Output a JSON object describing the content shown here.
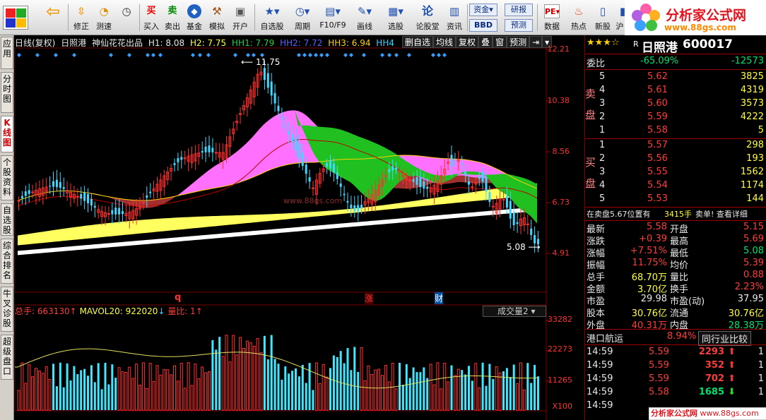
{
  "toolbar": {
    "items": [
      {
        "label": "",
        "icon": "app-logo-icon"
      },
      {
        "label": "",
        "icon": "back-arrow-icon"
      },
      {
        "label": "修正",
        "icon": "modify-icon"
      },
      {
        "label": "测速",
        "icon": "speed-test-icon"
      },
      {
        "label": "买入",
        "icon": "buy-icon",
        "glyph": "买"
      },
      {
        "label": "卖出",
        "icon": "sell-icon",
        "glyph": "卖"
      },
      {
        "label": "基金",
        "icon": "fund-icon"
      },
      {
        "label": "模拟",
        "icon": "hammer-icon"
      },
      {
        "label": "开户",
        "icon": "lock-icon"
      },
      {
        "label": "自选股",
        "icon": "watchlist-icon"
      },
      {
        "label": "周期",
        "icon": "clock-icon"
      },
      {
        "label": "F10/F9",
        "icon": "f10-icon"
      },
      {
        "label": "画线",
        "icon": "pencil-icon"
      },
      {
        "label": "选股",
        "icon": "select-stock-icon"
      },
      {
        "label": "论股堂",
        "icon": "forum-icon",
        "glyph": "论"
      },
      {
        "label": "资讯",
        "icon": "news-icon"
      },
      {
        "label": "资金",
        "icon": "capital-icon"
      },
      {
        "label": "BBD",
        "icon": "bbd-icon"
      },
      {
        "label": "研报",
        "icon": "research-icon"
      },
      {
        "label": "预测",
        "icon": "forecast-icon"
      },
      {
        "label": "数据",
        "icon": "data-icon"
      },
      {
        "label": "热点",
        "icon": "hot-icon"
      },
      {
        "label": "新股",
        "icon": "ipo-icon"
      },
      {
        "label": "沪",
        "icon": "sh-icon"
      }
    ],
    "brand_title": "分析家公式网",
    "brand_url": "www.88gs.com"
  },
  "left_tabs": [
    "应用",
    "分时图",
    "K线图",
    "个股资料",
    "自选股",
    "综合排名",
    "牛叉诊股",
    "超级盘口"
  ],
  "kline": {
    "period": "日线(复权)",
    "stock": "日照港",
    "indicator": "神仙花花出品",
    "h1": "H1: 8.08",
    "h2": "H2: 7.75",
    "hh1": "HH1: 7.79",
    "hh2": "HH2: 7.72",
    "hh3": "HH3: 6.94",
    "hh4": "HH4",
    "buttons": [
      "删自选",
      "均线",
      "复权",
      "叠",
      "窗",
      "预测"
    ],
    "y_labels": [
      "12.21",
      "10.38",
      "8.56",
      "6.73",
      "4.91"
    ],
    "high_note": "11.75",
    "low_note": "5.08",
    "marks": [
      "q",
      "涨",
      "财"
    ],
    "watermark": "www.88gs.com"
  },
  "volume": {
    "total": "总手: 663130",
    "mavol": "MAVOL20: 922020",
    "ratio": "量比: 1",
    "selector": "成交量2",
    "y_labels": [
      "33282",
      "22273",
      "11265"
    ],
    "unit": "X100"
  },
  "quote": {
    "stars": "★★★☆",
    "prefix": "R",
    "name": "日照港",
    "code": "600017",
    "weibi_label": "委比",
    "weibi": "-65.09%",
    "weicha": "-12573",
    "sell_label": "卖盘",
    "buy_label": "买盘",
    "sells": [
      {
        "lvl": "5",
        "price": "5.62",
        "vol": "3825"
      },
      {
        "lvl": "4",
        "price": "5.61",
        "vol": "4319"
      },
      {
        "lvl": "3",
        "price": "5.60",
        "vol": "3573"
      },
      {
        "lvl": "2",
        "price": "5.59",
        "vol": "4222"
      },
      {
        "lvl": "1",
        "price": "5.58",
        "vol": "5"
      }
    ],
    "buys": [
      {
        "lvl": "1",
        "price": "5.57",
        "vol": "298"
      },
      {
        "lvl": "2",
        "price": "5.56",
        "vol": "193"
      },
      {
        "lvl": "3",
        "price": "5.55",
        "vol": "1562"
      },
      {
        "lvl": "4",
        "price": "5.54",
        "vol": "1174"
      },
      {
        "lvl": "5",
        "price": "5.53",
        "vol": "144"
      }
    ],
    "notice_left": "在卖盘5.67位置有",
    "notice_mid": "3415手",
    "notice_right": "卖单! 查看详细",
    "stats": [
      {
        "k1": "最新",
        "v1": "5.58",
        "k2": "开盘",
        "v2": "5.15"
      },
      {
        "k1": "涨跌",
        "v1": "+0.39",
        "k2": "最高",
        "v2": "5.69"
      },
      {
        "k1": "涨幅",
        "v1": "+7.51%",
        "k2": "最低",
        "v2": "5.08"
      },
      {
        "k1": "振幅",
        "v1": "11.75%",
        "k2": "均价",
        "v2": "5.39"
      },
      {
        "k1": "总手",
        "v1": "68.70万",
        "k2": "量比",
        "v2": "0.88"
      },
      {
        "k1": "金额",
        "v1": "3.70亿",
        "k2": "换手",
        "v2": "2.23%"
      },
      {
        "k1": "市盈",
        "v1": "29.98",
        "k2": "市盈(动)",
        "v2": "37.95"
      },
      {
        "k1": "股本",
        "v1": "30.76亿",
        "k2": "流通",
        "v2": "30.76亿"
      },
      {
        "k1": "外盘",
        "v1": "40.31万",
        "k2": "内盘",
        "v2": "28.38万"
      }
    ],
    "sector": "港口航运",
    "sector_pct": "8.94%",
    "compare_btn": "同行业比较",
    "ticks": [
      {
        "t": "14:59",
        "p": "5.59",
        "v": "2293",
        "d": "up",
        "n": "1"
      },
      {
        "t": "14:59",
        "p": "5.59",
        "v": "352",
        "d": "up",
        "n": "1"
      },
      {
        "t": "14:59",
        "p": "5.59",
        "v": "702",
        "d": "up",
        "n": "1"
      },
      {
        "t": "14:59",
        "p": "5.58",
        "v": "1685",
        "d": "down",
        "n": "1"
      },
      {
        "t": "14:59",
        "p": "",
        "v": "",
        "d": "",
        "n": ""
      }
    ],
    "footer_brand": "分析家公式网",
    "footer_url": "www.88gs.com"
  }
}
